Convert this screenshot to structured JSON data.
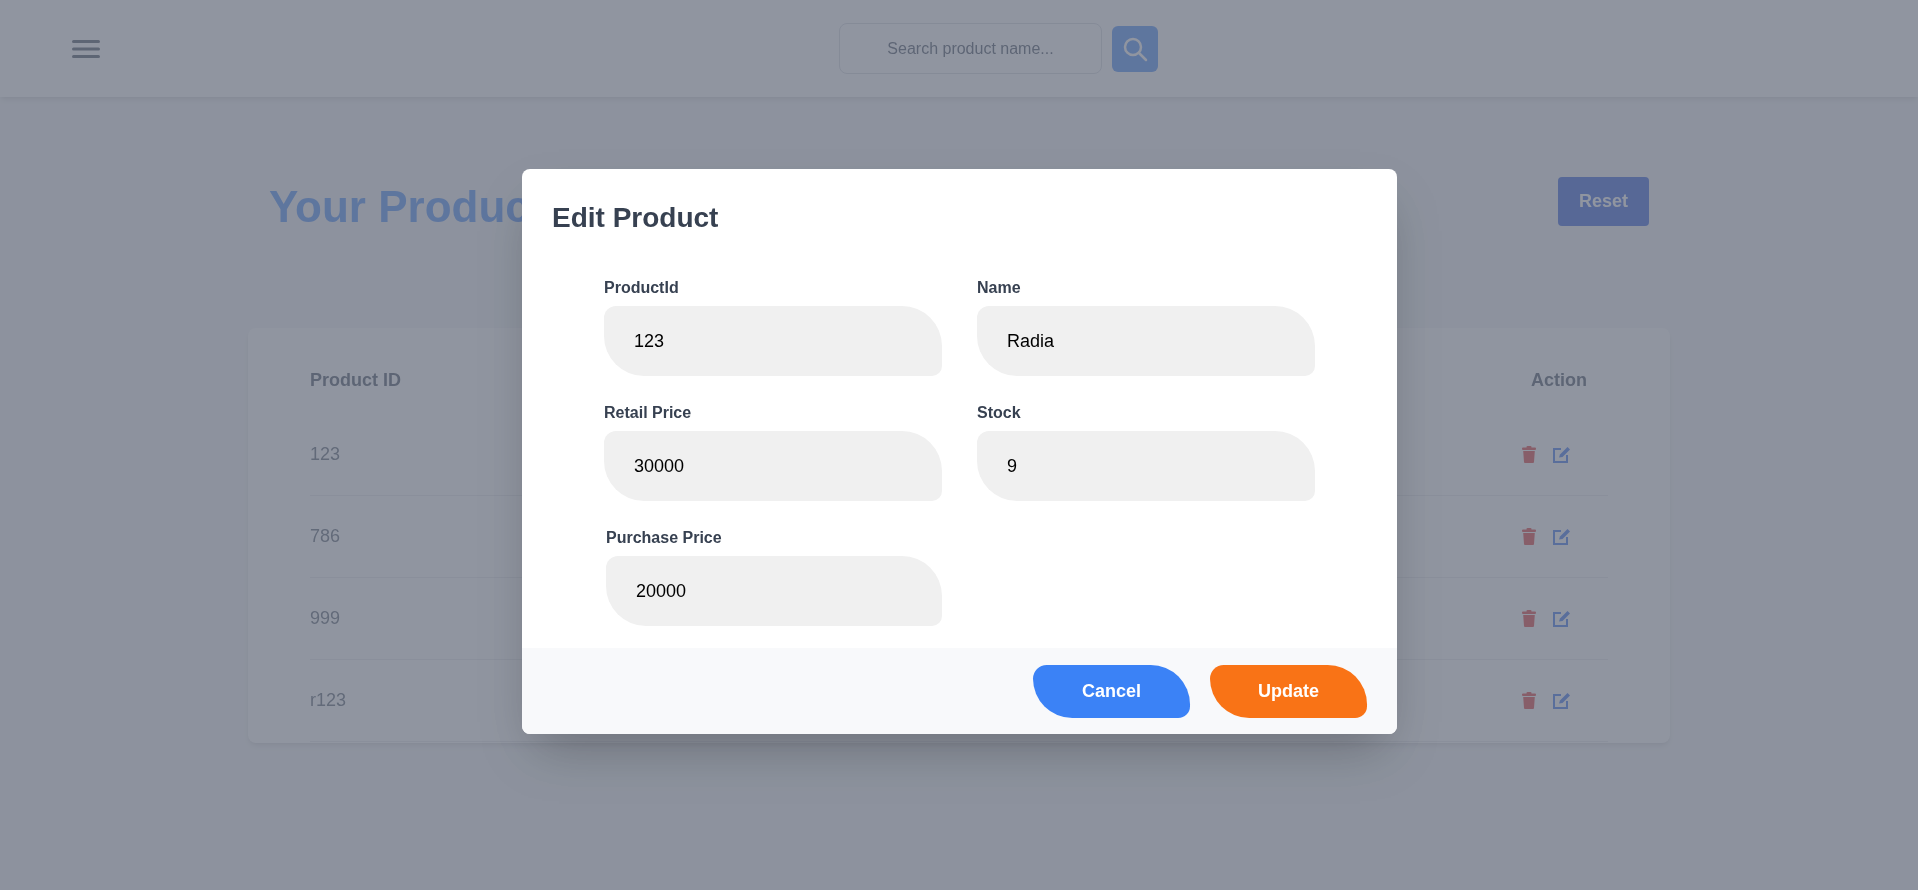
{
  "header": {
    "search": {
      "placeholder": "Search product name..."
    }
  },
  "page": {
    "title": "Your Produc",
    "reset_button": "Reset"
  },
  "table": {
    "columns": [
      "Product ID",
      "Action"
    ],
    "rows": [
      {
        "product_id": "123"
      },
      {
        "product_id": "786"
      },
      {
        "product_id": "999"
      },
      {
        "product_id": "r123"
      }
    ]
  },
  "modal": {
    "title": "Edit Product",
    "fields": [
      {
        "label": "ProductId",
        "value": "123"
      },
      {
        "label": "Name",
        "value": "Radia"
      },
      {
        "label": "Retail Price",
        "value": "30000"
      },
      {
        "label": "Stock",
        "value": "9"
      },
      {
        "label": "Purchase Price",
        "value": "20000"
      }
    ],
    "buttons": [
      {
        "label": "Cancel",
        "kind": "cancel"
      },
      {
        "label": "Update",
        "kind": "update"
      }
    ]
  }
}
